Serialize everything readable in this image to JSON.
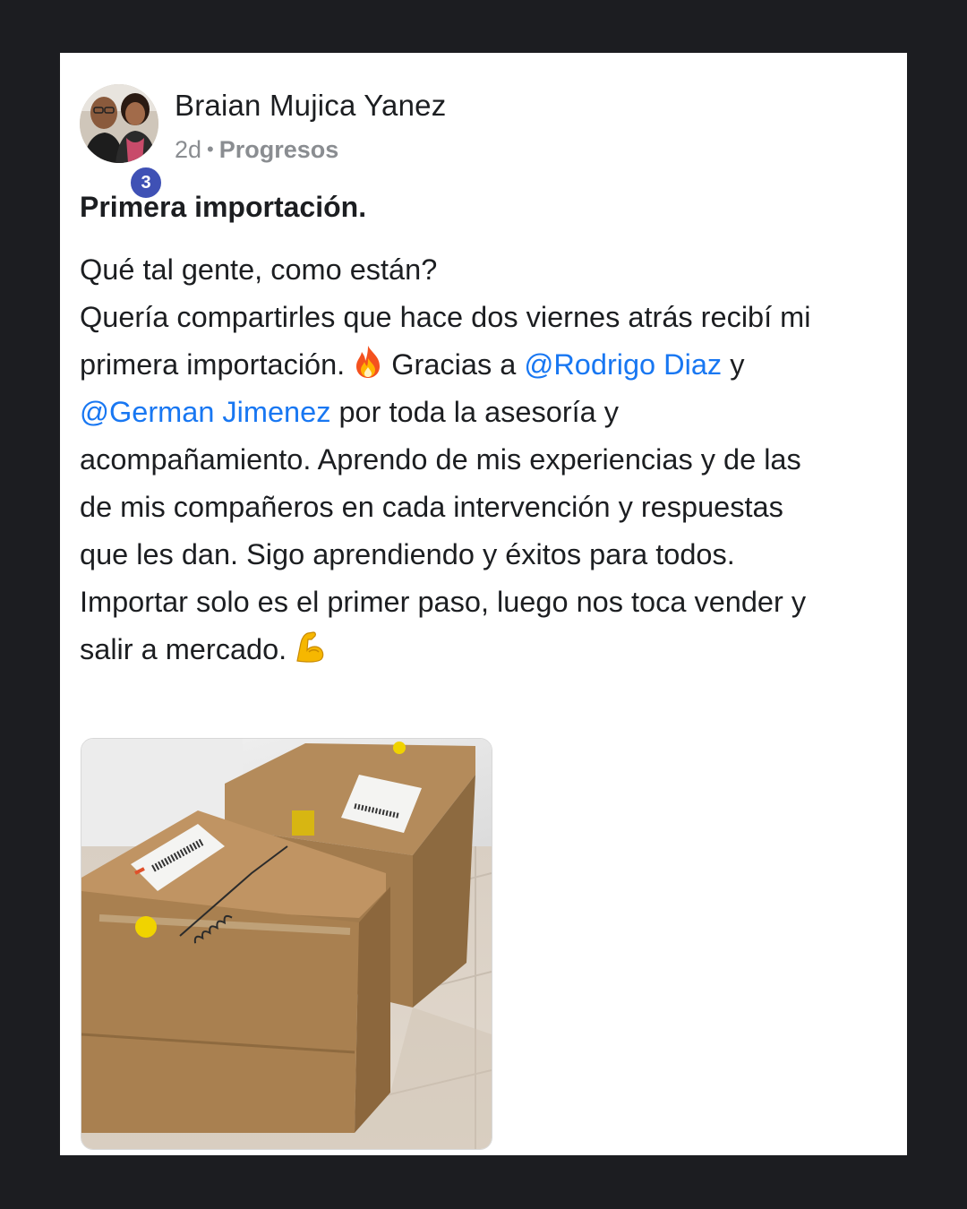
{
  "post": {
    "author": {
      "name": "Braian Mujica Yanez",
      "avatar_icon": "avatar-photo-icon",
      "level": "3"
    },
    "time": "2d",
    "separator": "•",
    "category": "Progresos",
    "title": "Primera importación.",
    "body": {
      "line1": "Qué tal gente, como están?",
      "line2": "Quería compartirles que hace dos viernes atrás recibí mi",
      "line3a": "primera importación.",
      "line3b": "Gracias a",
      "mention1": "@Rodrigo Diaz",
      "line3c": "y",
      "mention2": "@German Jimenez",
      "line4b": "por toda la asesoría y",
      "line5": "acompañamiento. Aprendo de mis experiencias y de las",
      "line6": "de mis compañeros en cada intervención y respuestas",
      "line7": "que les dan. Sigo aprendiendo y éxitos para todos.",
      "line8": "Importar solo es el primer paso, luego nos toca vender y",
      "line9": "salir a mercado."
    },
    "emojis": {
      "fire": "fire-emoji-icon",
      "muscle": "flexed-biceps-emoji-icon"
    },
    "image": {
      "subject": "cardboard-boxes-photo"
    },
    "colors": {
      "background": "#1c1d21",
      "card": "#ffffff",
      "mention": "#1877f2",
      "badge": "#3f51b5",
      "meta": "#8a8d91"
    }
  }
}
